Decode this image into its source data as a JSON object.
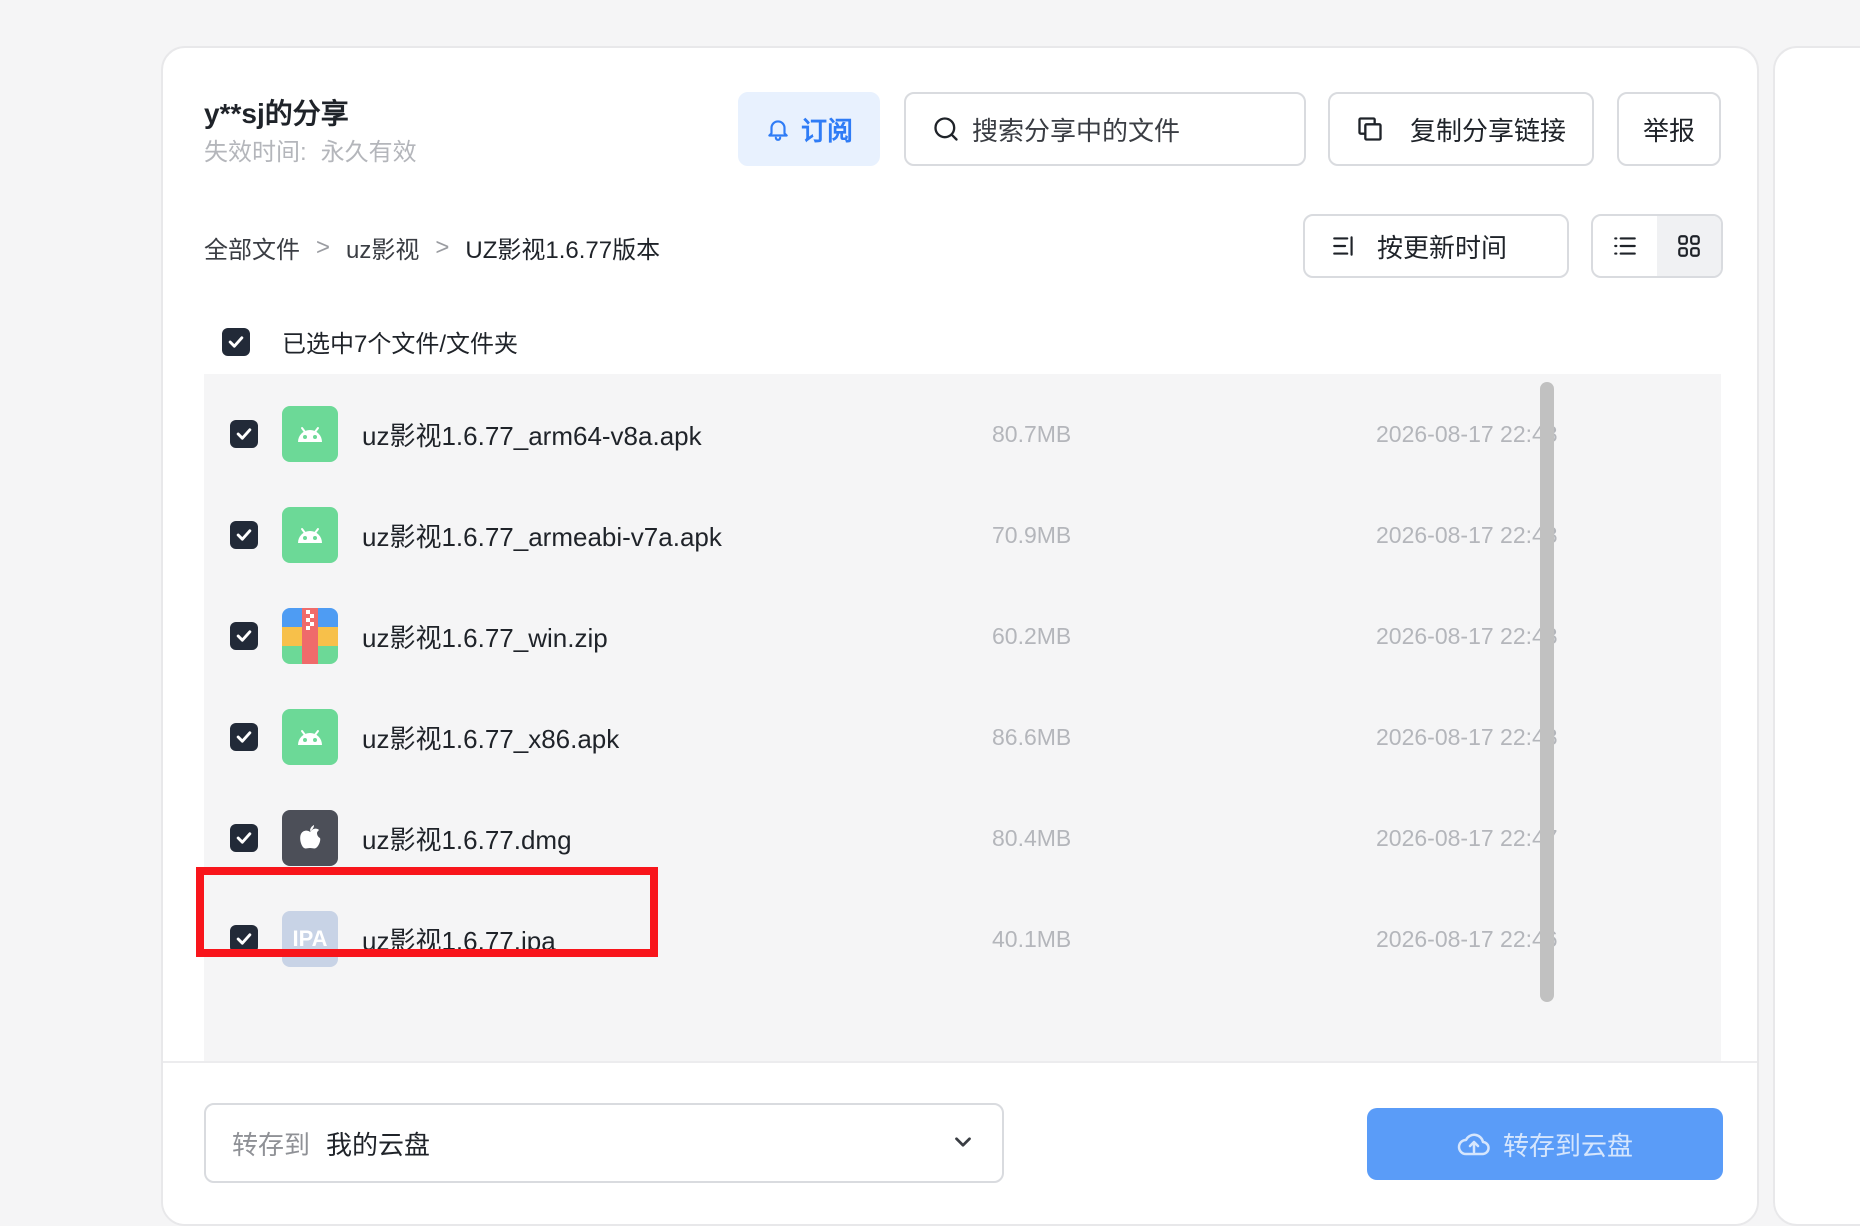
{
  "share": {
    "title": "y**sj的分享",
    "expire_label": "失效时间:",
    "expire_value": "永久有效"
  },
  "toolbar": {
    "subscribe_label": "订阅",
    "search_placeholder": "搜索分享中的文件",
    "copy_link_label": "复制分享链接",
    "report_label": "举报"
  },
  "breadcrumb": {
    "items": [
      "全部文件",
      "uz影视",
      "UZ影视1.6.77版本"
    ],
    "separator": ">"
  },
  "sort": {
    "label": "按更新时间"
  },
  "view": {
    "options": [
      "list-view-icon",
      "grid-view-icon"
    ],
    "active": "grid-view-icon"
  },
  "selection": {
    "label": "已选中7个文件/文件夹",
    "checked": true
  },
  "files": [
    {
      "name": "uz影视1.6.77_arm64-v8a.apk",
      "size": "80.7MB",
      "date": "2026-08-17 22:48",
      "icon": "android-icon",
      "checked": true
    },
    {
      "name": "uz影视1.6.77_armeabi-v7a.apk",
      "size": "70.9MB",
      "date": "2026-08-17 22:48",
      "icon": "android-icon",
      "checked": true
    },
    {
      "name": "uz影视1.6.77_win.zip",
      "size": "60.2MB",
      "date": "2026-08-17 22:48",
      "icon": "zip-icon",
      "checked": true
    },
    {
      "name": "uz影视1.6.77_x86.apk",
      "size": "86.6MB",
      "date": "2026-08-17 22:48",
      "icon": "android-icon",
      "checked": true
    },
    {
      "name": "uz影视1.6.77.dmg",
      "size": "80.4MB",
      "date": "2026-08-17 22:47",
      "icon": "apple-icon",
      "checked": true
    },
    {
      "name": "uz影视1.6.77.ipa",
      "size": "40.1MB",
      "date": "2026-08-17 22:46",
      "icon": "ipa-icon",
      "icon_text": "IPA",
      "checked": true
    }
  ],
  "footer": {
    "dest_label": "转存到",
    "dest_value": "我的云盘",
    "save_button_label": "转存到云盘"
  },
  "colors": {
    "accent": "#2f7cf6",
    "android_green": "#6cd997",
    "highlight_red": "#f8151b",
    "save_button": "#5a9cf8"
  }
}
